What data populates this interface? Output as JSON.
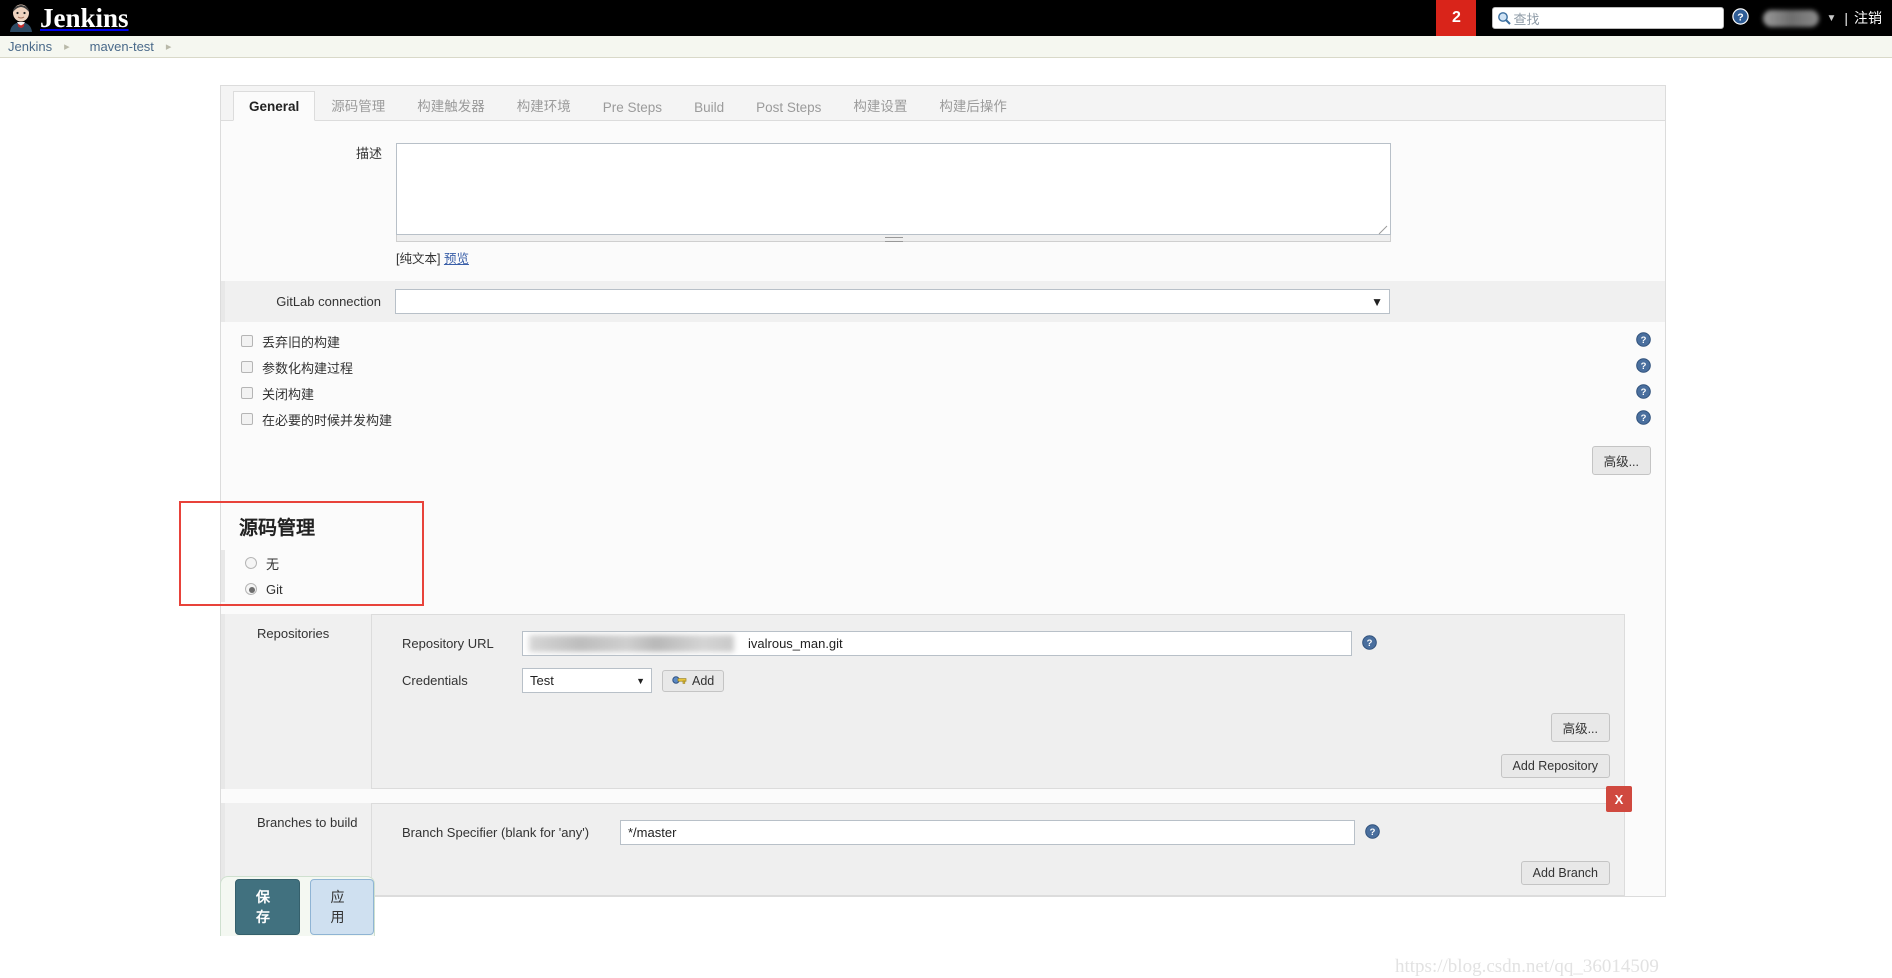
{
  "header": {
    "brand": "Jenkins",
    "logo_icon": "jenkins-butler-icon",
    "notification_count": "2",
    "search_icon": "search-icon",
    "search_placeholder": "查找",
    "search_value": "",
    "help_icon": "help-icon",
    "user_name": "",
    "caret_icon": "chevron-down-icon",
    "separator": "|",
    "logout_label": "注销"
  },
  "breadcrumb": {
    "items": [
      {
        "label": "Jenkins"
      },
      {
        "label": "maven-test"
      }
    ],
    "separator_icon": "chevron-right-icon"
  },
  "tabs": [
    {
      "label": "General",
      "active": true
    },
    {
      "label": "源码管理",
      "active": false
    },
    {
      "label": "构建触发器",
      "active": false
    },
    {
      "label": "构建环境",
      "active": false
    },
    {
      "label": "Pre Steps",
      "active": false
    },
    {
      "label": "Build",
      "active": false
    },
    {
      "label": "Post Steps",
      "active": false
    },
    {
      "label": "构建设置",
      "active": false
    },
    {
      "label": "构建后操作",
      "active": false
    }
  ],
  "general": {
    "description_label": "描述",
    "description_value": "",
    "plain_text_label": "[纯文本]",
    "preview_label": "预览",
    "gitlab_connection_label": "GitLab connection",
    "gitlab_connection_value": "",
    "checkboxes": [
      {
        "label": "丢弃旧的构建",
        "checked": false
      },
      {
        "label": "参数化构建过程",
        "checked": false
      },
      {
        "label": "关闭构建",
        "checked": false
      },
      {
        "label": "在必要的时候并发构建",
        "checked": false
      }
    ],
    "advanced_label": "高级..."
  },
  "scm": {
    "title": "源码管理",
    "options": [
      {
        "label": "无",
        "selected": false
      },
      {
        "label": "Git",
        "selected": true
      }
    ],
    "repositories": {
      "section_label": "Repositories",
      "url_label": "Repository URL",
      "url_value": "ivalrous_man.git",
      "url_redacted": true,
      "credentials_label": "Credentials",
      "credentials_value": "Test",
      "add_credentials_label": "Add",
      "add_credentials_icon": "key-icon",
      "advanced_label": "高级...",
      "add_repository_label": "Add Repository"
    },
    "branches": {
      "section_label": "Branches to build",
      "specifier_label": "Branch Specifier (blank for 'any')",
      "specifier_value": "*/master",
      "delete_label": "X",
      "add_branch_label": "Add Branch"
    }
  },
  "footer": {
    "save_label": "保存",
    "apply_label": "应用"
  },
  "watermark": "https://blog.csdn.net/qq_36014509",
  "colors": {
    "accent_red": "#d9241a",
    "annotation_red": "#e8423a",
    "save_teal": "#41717f",
    "apply_blue": "#cfe0f0",
    "link_blue": "#3a5fa8"
  }
}
